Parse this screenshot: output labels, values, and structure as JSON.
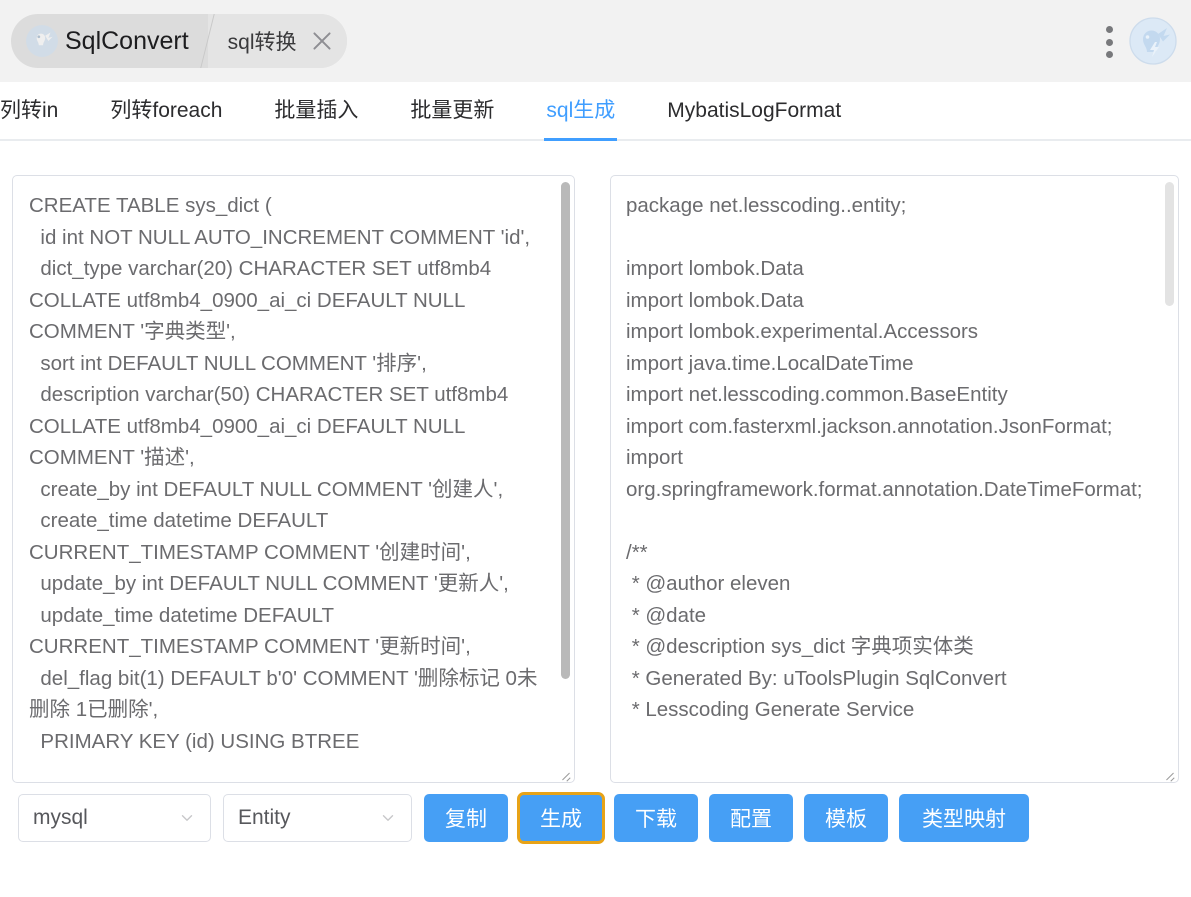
{
  "titlebar": {
    "plugin_name": "SqlConvert",
    "plugin_action": "sql转换",
    "close_icon": "close-icon",
    "menu_icon": "more-vertical-icon",
    "brand_icon": "app-logo-icon"
  },
  "tabs": [
    {
      "label": "列转in",
      "active": false
    },
    {
      "label": "列转foreach",
      "active": false
    },
    {
      "label": "批量插入",
      "active": false
    },
    {
      "label": "批量更新",
      "active": false
    },
    {
      "label": "sql生成",
      "active": true
    },
    {
      "label": "MybatisLogFormat",
      "active": false
    }
  ],
  "editors": {
    "input_sql": "CREATE TABLE sys_dict (\n  id int NOT NULL AUTO_INCREMENT COMMENT 'id',\n  dict_type varchar(20) CHARACTER SET utf8mb4 COLLATE utf8mb4_0900_ai_ci DEFAULT NULL COMMENT '字典类型',\n  sort int DEFAULT NULL COMMENT '排序',\n  description varchar(50) CHARACTER SET utf8mb4 COLLATE utf8mb4_0900_ai_ci DEFAULT NULL COMMENT '描述',\n  create_by int DEFAULT NULL COMMENT '创建人',\n  create_time datetime DEFAULT CURRENT_TIMESTAMP COMMENT '创建时间',\n  update_by int DEFAULT NULL COMMENT '更新人',\n  update_time datetime DEFAULT CURRENT_TIMESTAMP COMMENT '更新时间',\n  del_flag bit(1) DEFAULT b'0' COMMENT '删除标记 0未删除 1已删除',\n  PRIMARY KEY (id) USING BTREE",
    "output_code": "package net.lesscoding..entity;\n\nimport lombok.Data\nimport lombok.Data\nimport lombok.experimental.Accessors\nimport java.time.LocalDateTime\nimport net.lesscoding.common.BaseEntity\nimport com.fasterxml.jackson.annotation.JsonFormat;\nimport org.springframework.format.annotation.DateTimeFormat;\n\n/**\n * @author eleven\n * @date\n * @description sys_dict 字典项实体类\n * Generated By: uToolsPlugin SqlConvert\n * Lesscoding Generate Service"
  },
  "toolbar": {
    "db_select": {
      "value": "mysql",
      "caret_icon": "chevron-down-icon"
    },
    "type_select": {
      "value": "Entity",
      "caret_icon": "chevron-down-icon"
    },
    "buttons": [
      {
        "label": "复制",
        "focused": false
      },
      {
        "label": "生成",
        "focused": true
      },
      {
        "label": "下载",
        "focused": false
      },
      {
        "label": "配置",
        "focused": false
      },
      {
        "label": "模板",
        "focused": false
      },
      {
        "label": "类型映射",
        "focused": false
      }
    ]
  },
  "colors": {
    "accent_blue": "#409eff",
    "button_blue": "#469ff5",
    "focus_ring": "#e8a317",
    "titlebar_bg": "#f2f2f2",
    "pill_bg": "#dcdcdc"
  }
}
